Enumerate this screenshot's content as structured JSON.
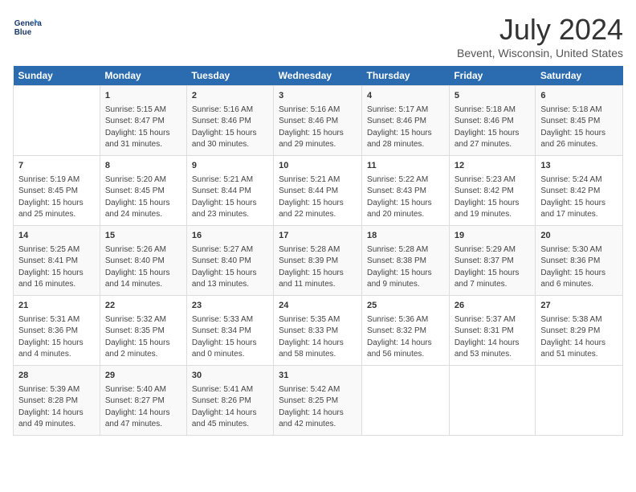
{
  "logo": {
    "line1": "General",
    "line2": "Blue"
  },
  "title": "July 2024",
  "subtitle": "Bevent, Wisconsin, United States",
  "days_header": [
    "Sunday",
    "Monday",
    "Tuesday",
    "Wednesday",
    "Thursday",
    "Friday",
    "Saturday"
  ],
  "weeks": [
    [
      {
        "num": "",
        "info": ""
      },
      {
        "num": "1",
        "info": "Sunrise: 5:15 AM\nSunset: 8:47 PM\nDaylight: 15 hours\nand 31 minutes."
      },
      {
        "num": "2",
        "info": "Sunrise: 5:16 AM\nSunset: 8:46 PM\nDaylight: 15 hours\nand 30 minutes."
      },
      {
        "num": "3",
        "info": "Sunrise: 5:16 AM\nSunset: 8:46 PM\nDaylight: 15 hours\nand 29 minutes."
      },
      {
        "num": "4",
        "info": "Sunrise: 5:17 AM\nSunset: 8:46 PM\nDaylight: 15 hours\nand 28 minutes."
      },
      {
        "num": "5",
        "info": "Sunrise: 5:18 AM\nSunset: 8:46 PM\nDaylight: 15 hours\nand 27 minutes."
      },
      {
        "num": "6",
        "info": "Sunrise: 5:18 AM\nSunset: 8:45 PM\nDaylight: 15 hours\nand 26 minutes."
      }
    ],
    [
      {
        "num": "7",
        "info": "Sunrise: 5:19 AM\nSunset: 8:45 PM\nDaylight: 15 hours\nand 25 minutes."
      },
      {
        "num": "8",
        "info": "Sunrise: 5:20 AM\nSunset: 8:45 PM\nDaylight: 15 hours\nand 24 minutes."
      },
      {
        "num": "9",
        "info": "Sunrise: 5:21 AM\nSunset: 8:44 PM\nDaylight: 15 hours\nand 23 minutes."
      },
      {
        "num": "10",
        "info": "Sunrise: 5:21 AM\nSunset: 8:44 PM\nDaylight: 15 hours\nand 22 minutes."
      },
      {
        "num": "11",
        "info": "Sunrise: 5:22 AM\nSunset: 8:43 PM\nDaylight: 15 hours\nand 20 minutes."
      },
      {
        "num": "12",
        "info": "Sunrise: 5:23 AM\nSunset: 8:42 PM\nDaylight: 15 hours\nand 19 minutes."
      },
      {
        "num": "13",
        "info": "Sunrise: 5:24 AM\nSunset: 8:42 PM\nDaylight: 15 hours\nand 17 minutes."
      }
    ],
    [
      {
        "num": "14",
        "info": "Sunrise: 5:25 AM\nSunset: 8:41 PM\nDaylight: 15 hours\nand 16 minutes."
      },
      {
        "num": "15",
        "info": "Sunrise: 5:26 AM\nSunset: 8:40 PM\nDaylight: 15 hours\nand 14 minutes."
      },
      {
        "num": "16",
        "info": "Sunrise: 5:27 AM\nSunset: 8:40 PM\nDaylight: 15 hours\nand 13 minutes."
      },
      {
        "num": "17",
        "info": "Sunrise: 5:28 AM\nSunset: 8:39 PM\nDaylight: 15 hours\nand 11 minutes."
      },
      {
        "num": "18",
        "info": "Sunrise: 5:28 AM\nSunset: 8:38 PM\nDaylight: 15 hours\nand 9 minutes."
      },
      {
        "num": "19",
        "info": "Sunrise: 5:29 AM\nSunset: 8:37 PM\nDaylight: 15 hours\nand 7 minutes."
      },
      {
        "num": "20",
        "info": "Sunrise: 5:30 AM\nSunset: 8:36 PM\nDaylight: 15 hours\nand 6 minutes."
      }
    ],
    [
      {
        "num": "21",
        "info": "Sunrise: 5:31 AM\nSunset: 8:36 PM\nDaylight: 15 hours\nand 4 minutes."
      },
      {
        "num": "22",
        "info": "Sunrise: 5:32 AM\nSunset: 8:35 PM\nDaylight: 15 hours\nand 2 minutes."
      },
      {
        "num": "23",
        "info": "Sunrise: 5:33 AM\nSunset: 8:34 PM\nDaylight: 15 hours\nand 0 minutes."
      },
      {
        "num": "24",
        "info": "Sunrise: 5:35 AM\nSunset: 8:33 PM\nDaylight: 14 hours\nand 58 minutes."
      },
      {
        "num": "25",
        "info": "Sunrise: 5:36 AM\nSunset: 8:32 PM\nDaylight: 14 hours\nand 56 minutes."
      },
      {
        "num": "26",
        "info": "Sunrise: 5:37 AM\nSunset: 8:31 PM\nDaylight: 14 hours\nand 53 minutes."
      },
      {
        "num": "27",
        "info": "Sunrise: 5:38 AM\nSunset: 8:29 PM\nDaylight: 14 hours\nand 51 minutes."
      }
    ],
    [
      {
        "num": "28",
        "info": "Sunrise: 5:39 AM\nSunset: 8:28 PM\nDaylight: 14 hours\nand 49 minutes."
      },
      {
        "num": "29",
        "info": "Sunrise: 5:40 AM\nSunset: 8:27 PM\nDaylight: 14 hours\nand 47 minutes."
      },
      {
        "num": "30",
        "info": "Sunrise: 5:41 AM\nSunset: 8:26 PM\nDaylight: 14 hours\nand 45 minutes."
      },
      {
        "num": "31",
        "info": "Sunrise: 5:42 AM\nSunset: 8:25 PM\nDaylight: 14 hours\nand 42 minutes."
      },
      {
        "num": "",
        "info": ""
      },
      {
        "num": "",
        "info": ""
      },
      {
        "num": "",
        "info": ""
      }
    ]
  ]
}
